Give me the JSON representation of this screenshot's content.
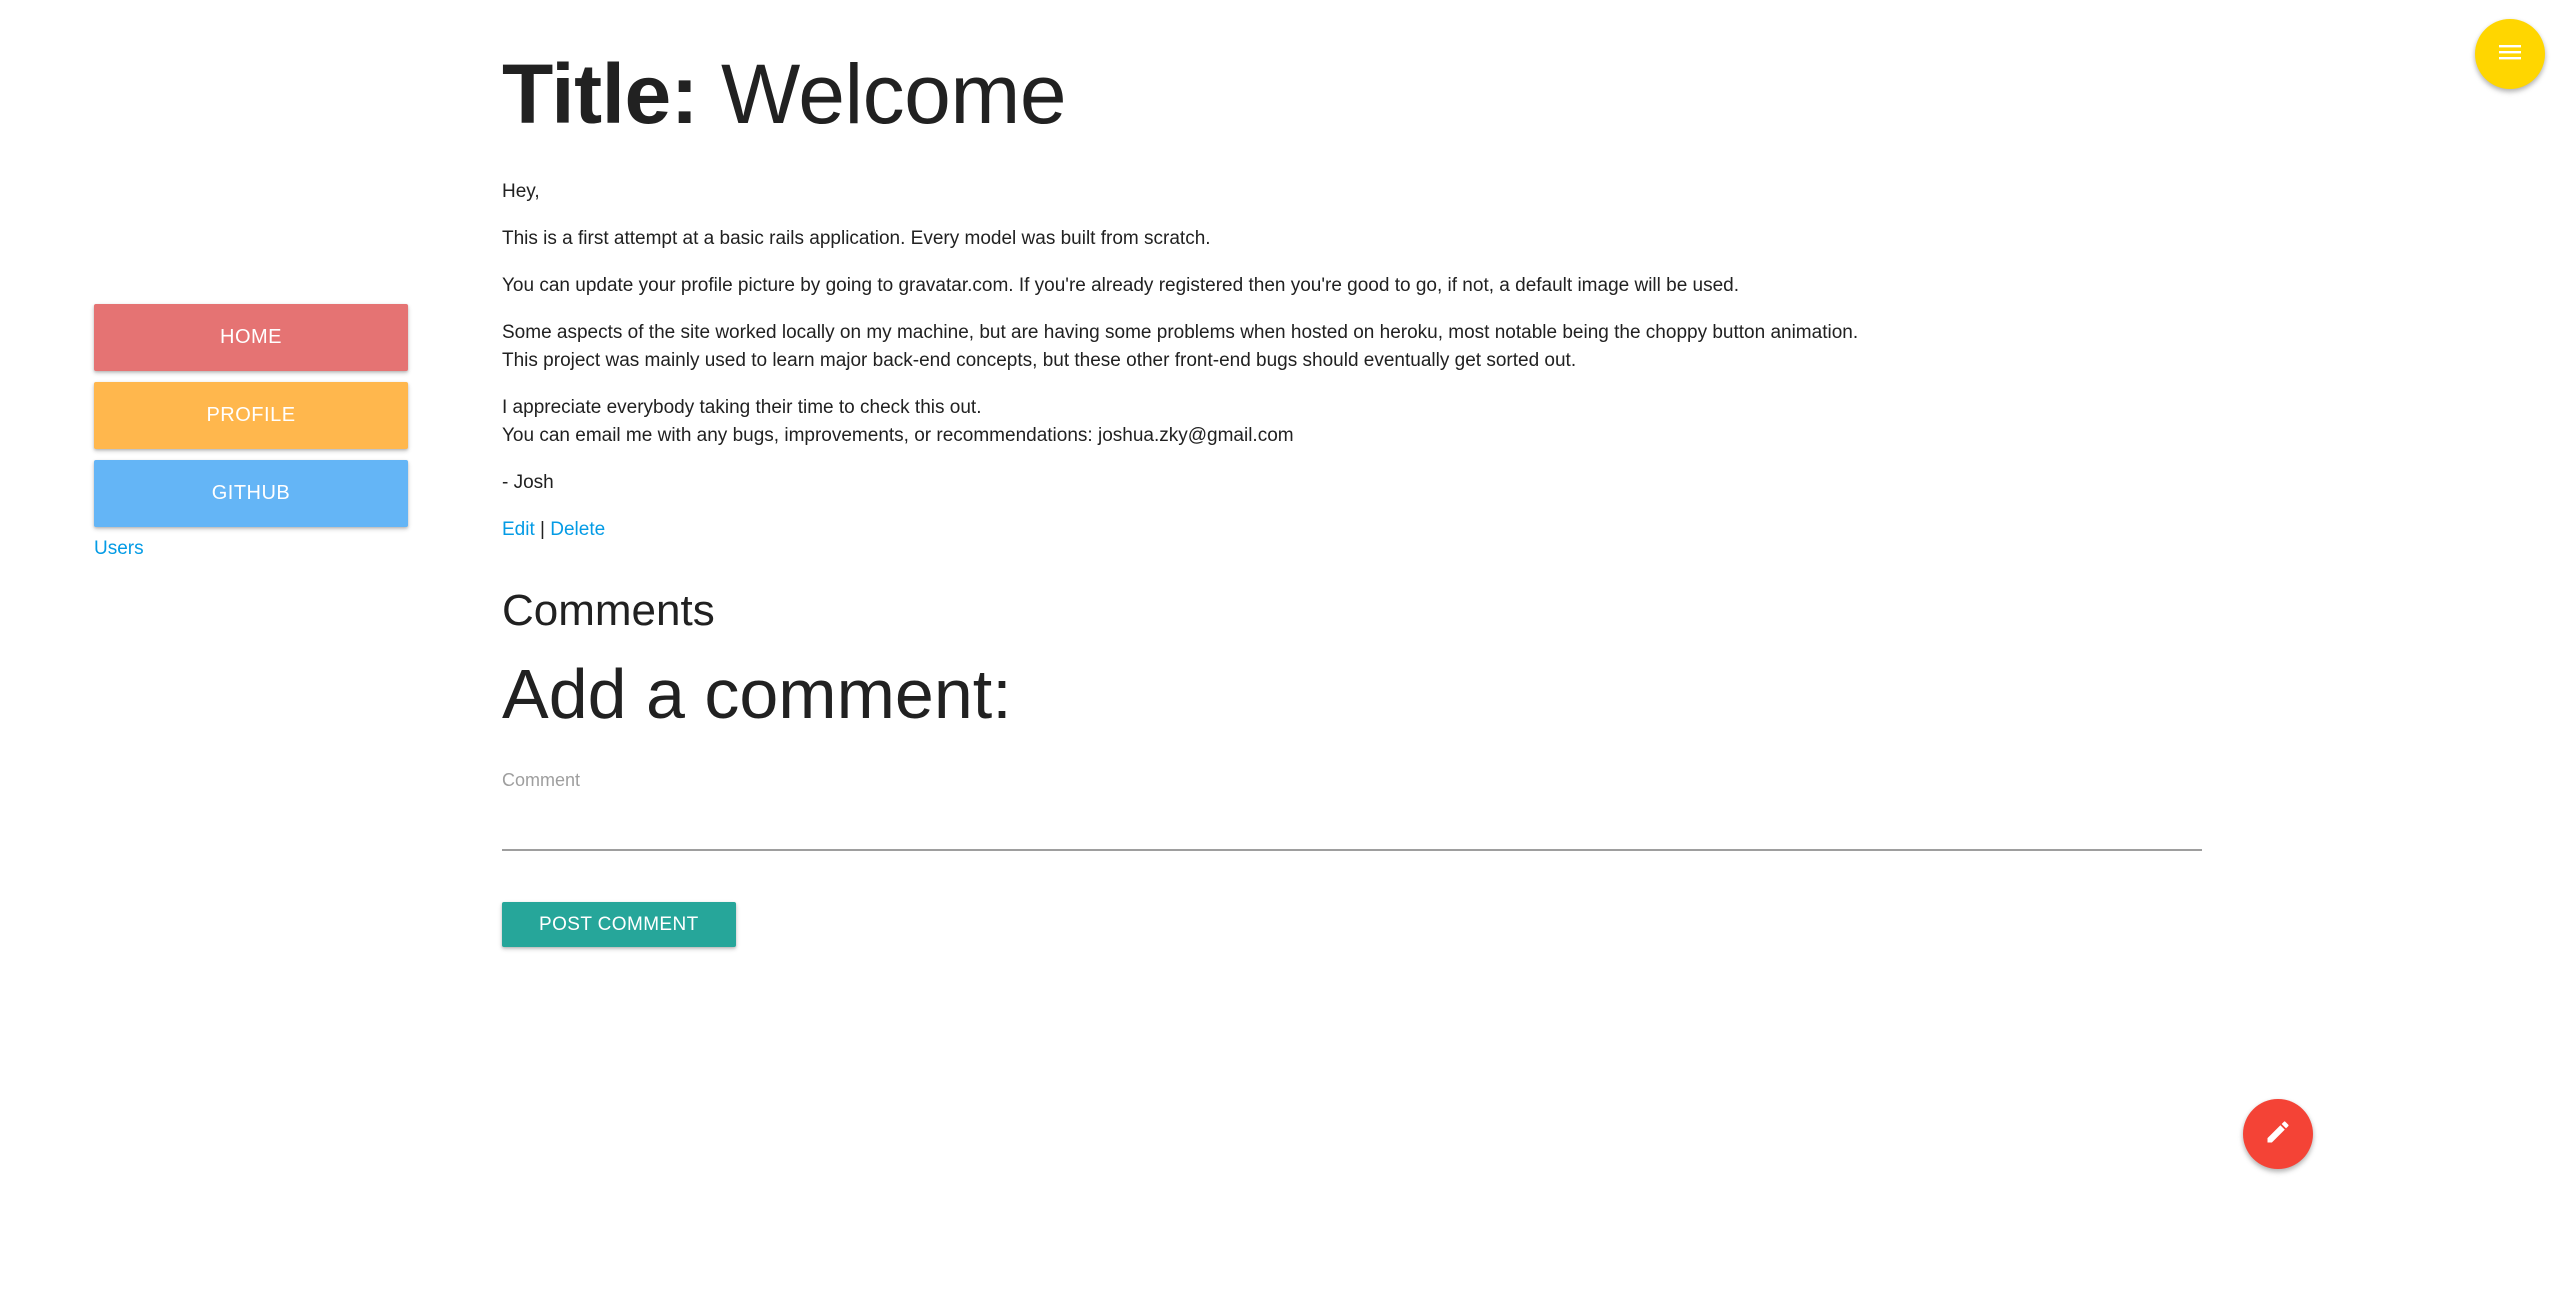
{
  "colors": {
    "home_button": "#e57373",
    "profile_button": "#ffb74d",
    "github_button": "#64b5f6",
    "link": "#039be5",
    "post_comment_button": "#26a69a",
    "menu_fab": "#ffd600",
    "edit_fab": "#f44336"
  },
  "sidebar": {
    "home_label": "HOME",
    "profile_label": "PROFILE",
    "github_label": "GITHUB",
    "users_link": "Users"
  },
  "post": {
    "title_prefix": "Title:",
    "title": "Welcome",
    "paragraphs": [
      "Hey,",
      "This is a first attempt at a basic rails application. Every model was built from scratch.",
      "You can update your profile picture by going to gravatar.com. If you're already registered then you're good to go, if not, a default image will be used.",
      "Some aspects of the site worked locally on my machine, but are having some problems when hosted on heroku, most notable being the choppy button animation.\nThis project was mainly used to learn major back-end concepts, but these other front-end bugs should eventually get sorted out.",
      "I appreciate everybody taking their time to check this out.\nYou can email me with any bugs, improvements, or recommendations: joshua.zky@gmail.com",
      "- Josh"
    ],
    "edit_link": "Edit",
    "separator": "|",
    "delete_link": "Delete"
  },
  "comments": {
    "heading": "Comments",
    "add_heading": "Add a comment:",
    "field_label": "Comment",
    "field_value": "",
    "submit_label": "POST COMMENT"
  },
  "icons": {
    "menu_fab": "menu-icon",
    "edit_fab": "pencil-icon"
  }
}
